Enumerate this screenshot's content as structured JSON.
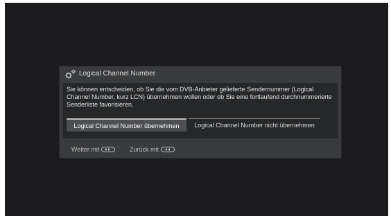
{
  "dialog": {
    "title": "Logical Channel Number",
    "title_icon": "gear-icon",
    "message": "Sie können entscheiden, ob Sie die vom DVB-Anbieter gelieferte Sendernummer (Logical Channel Number, kurz LCN) übernehmen wollen oder ob Sie eine fortlaufend durchnummerierte Senderliste favorisieren.",
    "options": [
      {
        "label": "Logical Channel Number übernehmen",
        "selected": true
      },
      {
        "label": "Logical Channel Number nicht übernehmen",
        "selected": false
      }
    ]
  },
  "footer": {
    "next_label": "Weiter mit",
    "next_icon": "fast-forward-key-icon",
    "back_label": "Zurück mit",
    "back_icon": "rewind-key-icon"
  },
  "colors": {
    "screen_background": "#1b1b1d",
    "dialog_background": "#3a3b3d",
    "panel_background": "#262729",
    "selected_option": "#4d4e50"
  }
}
